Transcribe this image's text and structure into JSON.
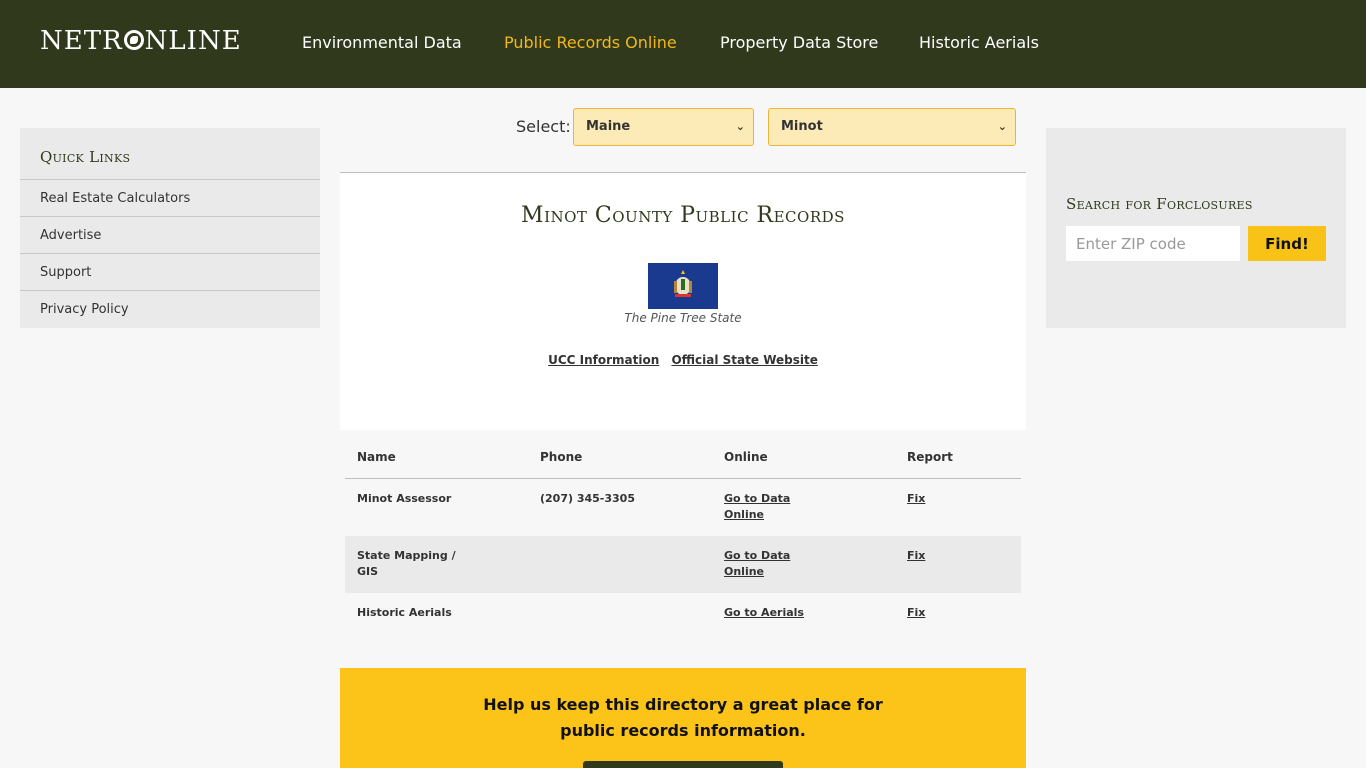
{
  "header": {
    "logo": {
      "left": "NETR",
      "right": "NLINE"
    },
    "nav": [
      {
        "label": "Environmental Data",
        "active": false
      },
      {
        "label": "Public Records Online",
        "active": true
      },
      {
        "label": "Property Data Store",
        "active": false
      },
      {
        "label": "Historic Aerials",
        "active": false
      }
    ]
  },
  "quick_links": {
    "title": "Quick Links",
    "items": [
      "Real Estate Calculators",
      "Advertise",
      "Support",
      "Privacy Policy"
    ]
  },
  "selector": {
    "label": "Select:",
    "state": "Maine",
    "county": "Minot"
  },
  "card": {
    "title": "Minot County Public Records",
    "flag_caption": "The Pine Tree State",
    "links": [
      "UCC Information",
      "Official State Website"
    ]
  },
  "table": {
    "headers": [
      "Name",
      "Phone",
      "Online",
      "Report"
    ],
    "rows": [
      {
        "name_1": "Minot Assessor",
        "name_2": "",
        "phone": "(207) 345-3305",
        "online_1": "Go to Data",
        "online_2": "Online",
        "report": "Fix"
      },
      {
        "name_1": "State Mapping /",
        "name_2": "GIS",
        "phone": "",
        "online_1": "Go to Data",
        "online_2": "Online",
        "report": "Fix"
      },
      {
        "name_1": "Historic Aerials",
        "name_2": "",
        "phone": "",
        "online_1": "Go to Aerials",
        "online_2": "",
        "report": "Fix"
      }
    ]
  },
  "search": {
    "title": "Search for Forclosures",
    "placeholder": "Enter ZIP code",
    "button": "Find!"
  },
  "help": {
    "line1": "Help us keep this directory a great place for",
    "line2": "public records information."
  },
  "colors": {
    "header_bg": "#30391c",
    "accent": "#f8c316",
    "nav_active": "#f3b71a"
  }
}
